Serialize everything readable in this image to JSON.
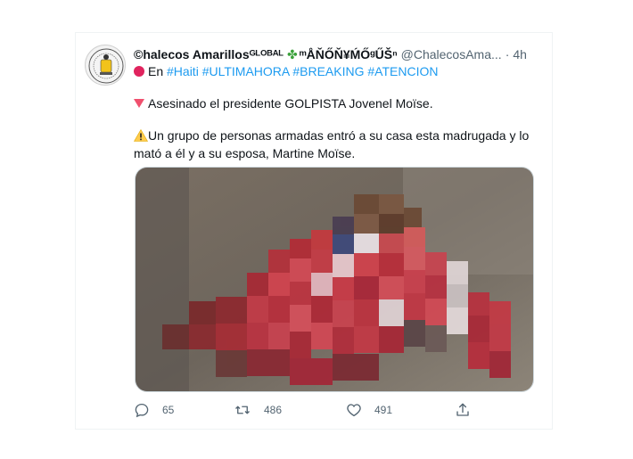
{
  "tweet": {
    "display_name": "©halecos Amarillosᴳᴸᴼᴮᴬᴸ",
    "name_suffix": "ᵐÅŇŐŇ¥ḾŐᵍŰŠⁿ",
    "handle": "@ChalecosAma...",
    "separator": "·",
    "time": "4h",
    "hashtag_prefix": "En",
    "hashtags": [
      "#Haiti",
      "#ULTIMAHORA",
      "#BREAKING",
      "#ATENCION"
    ],
    "line1": "Asesinado el presidente GOLPISTA Jovenel Moïse.",
    "line2": "Un grupo de personas armadas entró a su casa esta madrugada y lo",
    "line3": "mató a él y a su esposa, Martine Moïse."
  },
  "actions": {
    "replies": "65",
    "retweets": "486",
    "likes": "491"
  },
  "icons": {
    "avatar": "avatar-logo",
    "clover": "four-leaf-clover-icon",
    "red_circle": "red-circle-icon",
    "down_triangle": "red-down-triangle-icon",
    "warning": "warning-icon",
    "reply": "reply-icon",
    "retweet": "retweet-icon",
    "like": "heart-icon",
    "share": "share-icon"
  },
  "colors": {
    "hashtag": "#1d9bf0",
    "text": "#0f1419",
    "muted": "#536471"
  }
}
